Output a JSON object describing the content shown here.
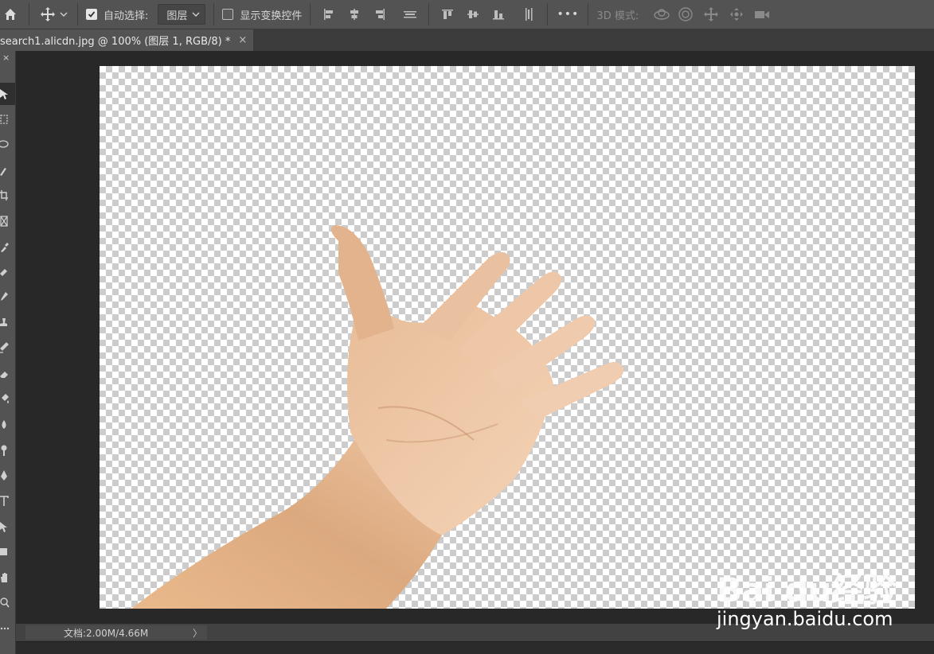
{
  "colors": {
    "panel": "#535353",
    "workspace": "#282828",
    "text": "#d6d6d6",
    "skin": "#e3b389"
  },
  "optbar": {
    "auto_select_label": "自动选择:",
    "auto_select_checked": true,
    "auto_select_target": "图层",
    "show_transform_label": "显示变换控件",
    "show_transform_checked": false,
    "mode_3d_label": "3D 模式:",
    "more_label": "•••"
  },
  "tab": {
    "title": "search1.alicdn.jpg @ 100% (图层 1, RGB/8) *",
    "close": "×"
  },
  "tools": {
    "close": "×"
  },
  "status": {
    "doc_size": "文档:2.00M/4.66M",
    "arrow": "〉"
  },
  "watermark": {
    "brand": "Bai du经验",
    "url": "jingyan.baidu.com"
  }
}
